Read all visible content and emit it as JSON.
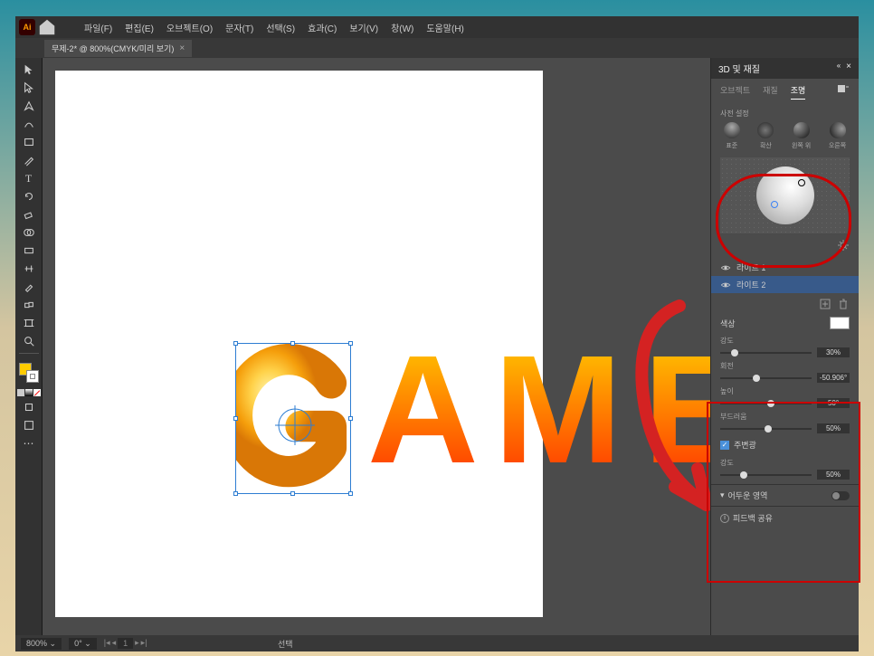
{
  "menubar": {
    "logo": "Ai",
    "items": [
      "파일(F)",
      "편집(E)",
      "오브젝트(O)",
      "문자(T)",
      "선택(S)",
      "효과(C)",
      "보기(V)",
      "창(W)",
      "도움말(H)"
    ]
  },
  "tab": {
    "title": "무제-2* @ 800%(CMYK/미리 보기)"
  },
  "canvas": {
    "text": "GAME",
    "letters": [
      "G",
      "A",
      "M",
      "E"
    ]
  },
  "panel": {
    "title": "3D 및 재질",
    "tabs": [
      "오브젝트",
      "재질",
      "조명"
    ],
    "activeTab": "조명",
    "presetLabel": "사전 설정",
    "presets": [
      "표준",
      "확산",
      "왼쪽 위",
      "오른쪽"
    ],
    "lights": [
      "라이트 1",
      "라이트 2"
    ],
    "colorLabel": "색상",
    "sliders": {
      "intensity": {
        "label": "강도",
        "value": "30%",
        "pos": 16
      },
      "rotation": {
        "label": "회전",
        "value": "-50.906°",
        "pos": 40
      },
      "height": {
        "label": "높이",
        "value": "50°",
        "pos": 55
      },
      "softness": {
        "label": "부드러움",
        "value": "50%",
        "pos": 52
      },
      "ambientIntensity": {
        "label": "강도",
        "value": "50%",
        "pos": 26
      }
    },
    "ambientLabel": "주변광",
    "darkRegion": "어두운 영역",
    "shareLabel": "피드백 공유"
  },
  "statusbar": {
    "zoom": "800%",
    "rotation": "0°",
    "toolLabel": "선택"
  }
}
